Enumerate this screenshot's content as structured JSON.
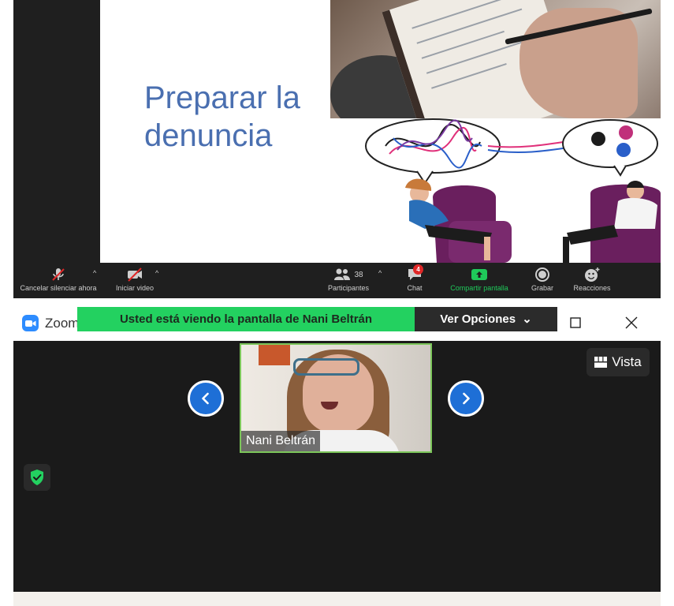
{
  "slide": {
    "title": "Preparar la denuncia"
  },
  "toolbar": {
    "mute_label": "Cancelar silenciar ahora",
    "video_label": "Iniciar video",
    "participants_count": "38",
    "participants_label": "Participantes",
    "chat_label": "Chat",
    "chat_badge": "4",
    "share_label": "Compartir pantalla",
    "record_label": "Grabar",
    "reactions_label": "Reacciones",
    "caret": "^"
  },
  "zoom": {
    "app_name": "Zoom",
    "share_banner": "Usted está viendo la pantalla de Nani Beltrán",
    "view_options": "Ver Opciones",
    "view_options_chevron": "⌄",
    "vista_label": "Vista",
    "participant_name": "Nani Beltrán"
  },
  "colors": {
    "accent_green": "#23d160",
    "zoom_blue": "#2d8cff",
    "nav_blue": "#1e6fd6",
    "slide_title": "#4a6fb0",
    "dark_bg": "#1f1f1f"
  },
  "icons": [
    "microphone-muted-icon",
    "video-off-icon",
    "participants-icon",
    "chat-icon",
    "share-screen-icon",
    "record-icon",
    "reactions-icon",
    "zoom-logo-icon",
    "maximize-icon",
    "close-icon",
    "chevron-left-icon",
    "chevron-right-icon",
    "grid-view-icon",
    "security-shield-icon"
  ]
}
